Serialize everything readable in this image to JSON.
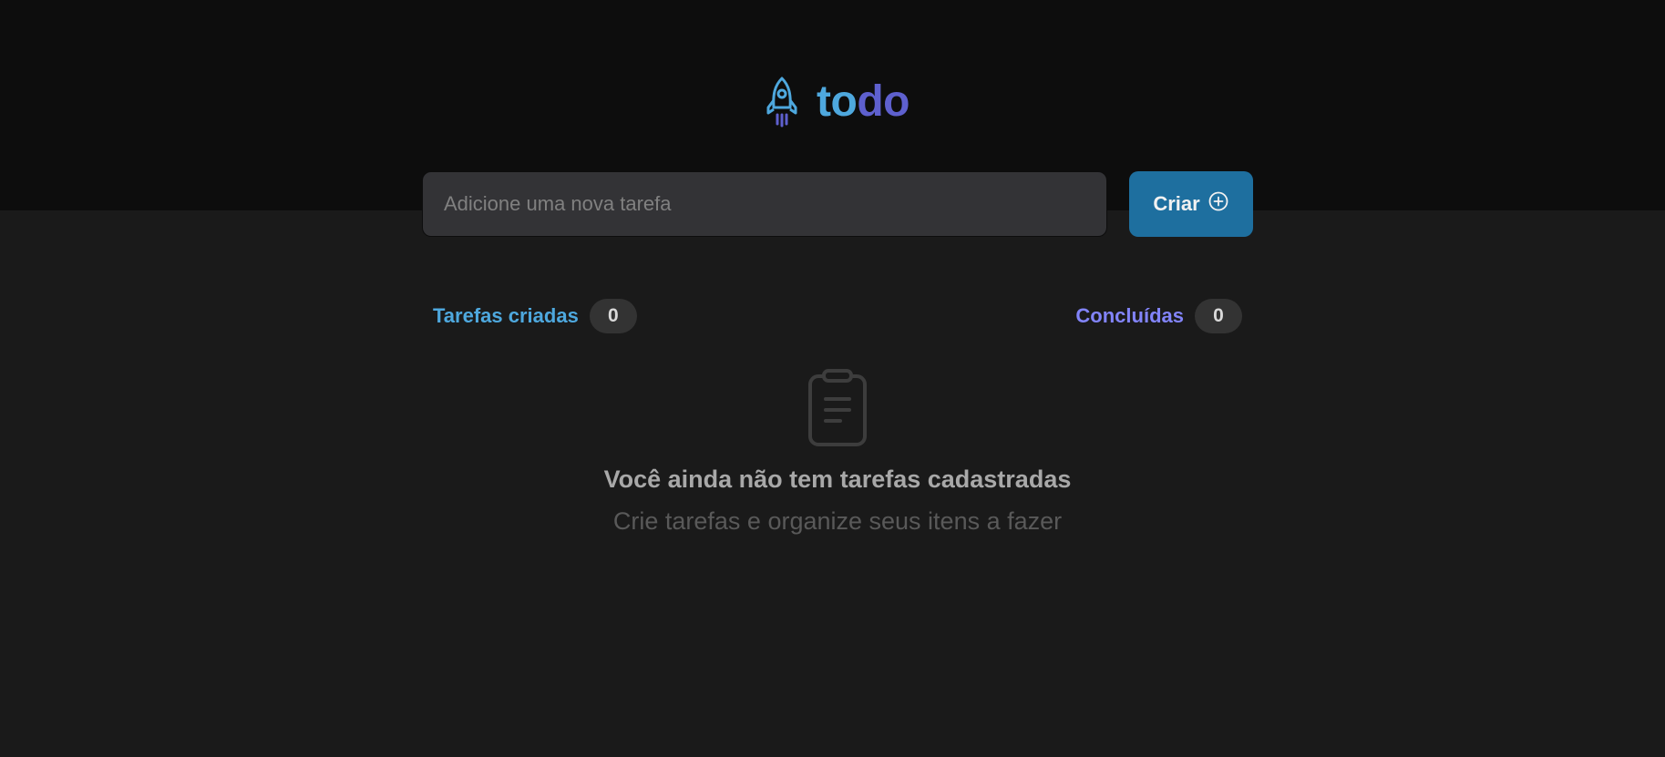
{
  "colors": {
    "header_bg": "#0d0d0d",
    "page_bg": "#1a1a1a",
    "input_bg": "#333336",
    "button_bg": "#1e6f9f",
    "blue": "#4ea8de",
    "purple": "#5e60ce",
    "purple_light": "#8284fa",
    "badge_bg": "#333333"
  },
  "header": {
    "logo_icon": "rocket-icon",
    "logo_text_part1": "to",
    "logo_text_part2": "do"
  },
  "new_task": {
    "value": "",
    "placeholder": "Adicione uma nova tarefa",
    "create_label": "Criar",
    "create_icon": "plus-circle-icon"
  },
  "counters": {
    "created_label": "Tarefas criadas",
    "created_count": "0",
    "done_label": "Concluídas",
    "done_count": "0"
  },
  "empty_state": {
    "icon": "clipboard-icon",
    "title": "Você ainda não tem tarefas cadastradas",
    "subtitle": "Crie tarefas e organize seus itens a fazer"
  }
}
